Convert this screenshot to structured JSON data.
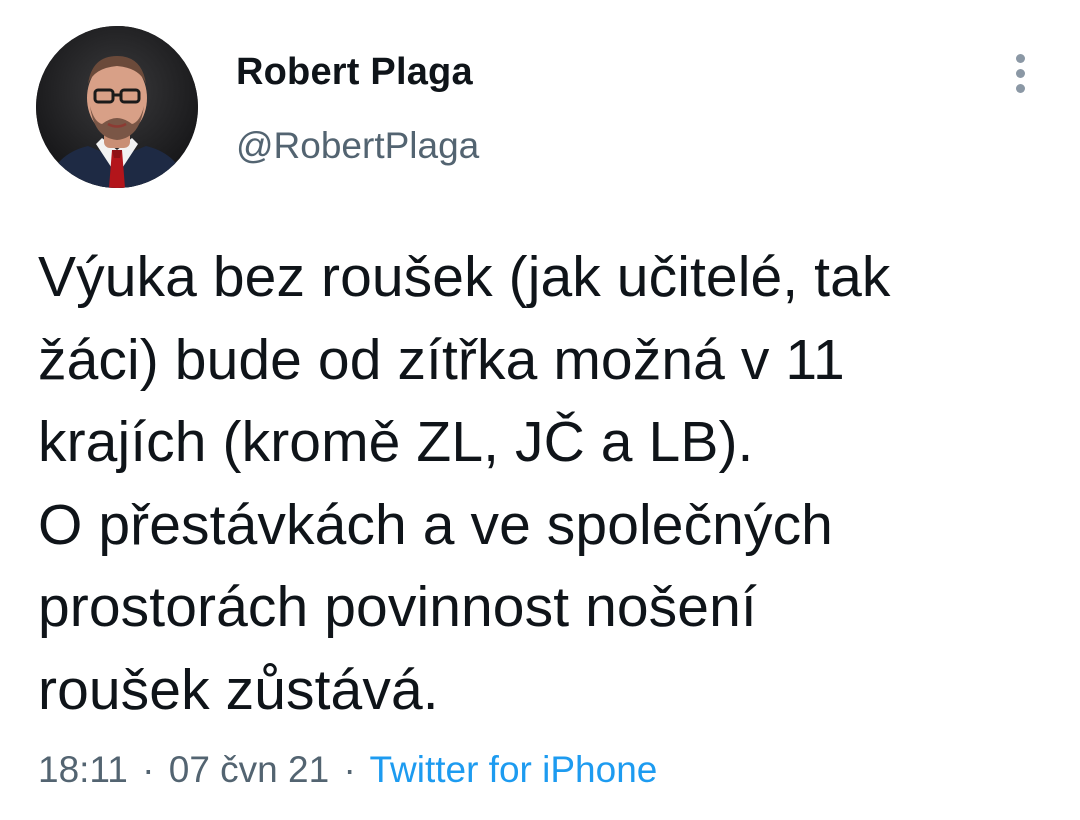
{
  "author": {
    "display_name": "Robert Plaga",
    "handle": "@RobertPlaga",
    "avatar_icon": "profile-photo"
  },
  "more_icon": "vertical-ellipsis-icon",
  "tweet": {
    "lines": [
      "Výuka bez roušek (jak učitelé, tak",
      "žáci) bude od zítřka možná v 11",
      "krajích (kromě ZL, JČ a LB).",
      "O přestávkách a ve společných",
      "prostorách povinnost nošení",
      "roušek zůstává."
    ]
  },
  "meta": {
    "time": "18:11",
    "separator": "·",
    "date": "07 čvn 21",
    "source": "Twitter for iPhone"
  },
  "colors": {
    "text": "#0f1419",
    "secondary": "#536471",
    "link": "#1d9bf0"
  }
}
